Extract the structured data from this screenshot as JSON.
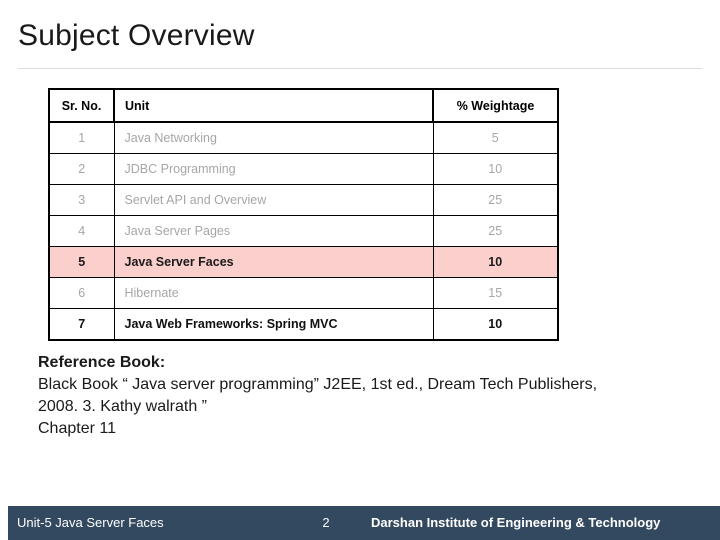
{
  "slide": {
    "title": "Subject Overview"
  },
  "table": {
    "headers": {
      "sr_no": "Sr. No.",
      "unit": "Unit",
      "weightage": "% Weightage"
    },
    "rows": [
      {
        "sr_no": "1",
        "unit": "Java Networking",
        "weightage": "5",
        "state": "dim"
      },
      {
        "sr_no": "2",
        "unit": "JDBC Programming",
        "weightage": "10",
        "state": "dim"
      },
      {
        "sr_no": "3",
        "unit": "Servlet API and Overview",
        "weightage": "25",
        "state": "dim"
      },
      {
        "sr_no": "4",
        "unit": "Java Server Pages",
        "weightage": "25",
        "state": "dim"
      },
      {
        "sr_no": "5",
        "unit": "Java Server Faces",
        "weightage": "10",
        "state": "active"
      },
      {
        "sr_no": "6",
        "unit": "Hibernate",
        "weightage": "15",
        "state": "dim"
      },
      {
        "sr_no": "7",
        "unit": "Java Web Frameworks: Spring MVC",
        "weightage": "10",
        "state": "dark"
      }
    ]
  },
  "reference": {
    "heading": "Reference Book:",
    "lines": [
      "Black Book “ Java server programming” J2EE, 1st ed., Dream Tech Publishers,",
      "2008. 3. Kathy walrath ”",
      "Chapter 11"
    ]
  },
  "footer": {
    "unit_label": "Unit-5 Java Server Faces",
    "page_number": "2",
    "organization": "Darshan Institute of Engineering & Technology"
  },
  "colors": {
    "footer_background": "#33495f",
    "highlight_row_background": "#fbcfcc",
    "highlight_row_border": "#c0504d",
    "dim_text": "#a6a6a6",
    "title_rule": "#dcdcdc"
  }
}
